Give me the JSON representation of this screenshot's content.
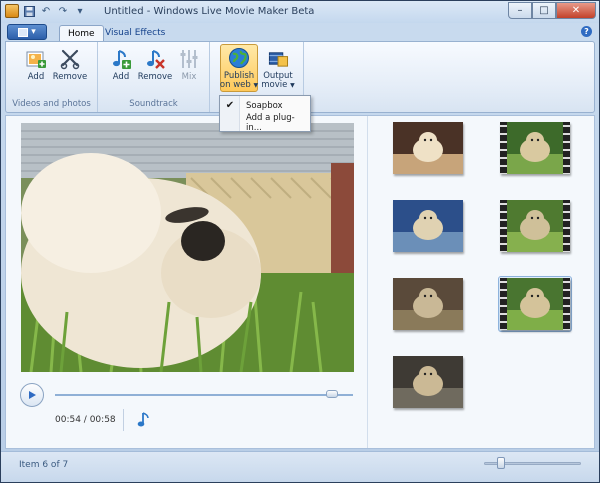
{
  "window": {
    "title": "Untitled - Windows Live Movie Maker Beta",
    "min_symbol": "–",
    "max_symbol": "□",
    "close_symbol": "✕"
  },
  "tabs": [
    {
      "label": "Home",
      "active": true
    },
    {
      "label": "Visual Effects",
      "active": false
    }
  ],
  "help_symbol": "?",
  "ribbon": {
    "groups": [
      {
        "label": "Videos and photos",
        "buttons": [
          {
            "label": "Add",
            "icon": "add-photo-icon"
          },
          {
            "label": "Remove",
            "icon": "remove-scissors-icon"
          }
        ]
      },
      {
        "label": "Soundtrack",
        "buttons": [
          {
            "label": "Add",
            "icon": "add-music-icon"
          },
          {
            "label": "Remove",
            "icon": "remove-music-icon"
          },
          {
            "label": "Mix",
            "icon": "mix-sliders-icon",
            "disabled": true
          }
        ]
      },
      {
        "label": "",
        "buttons": [
          {
            "label_line1": "Publish",
            "label_line2": "on web",
            "icon": "globe-icon",
            "pressed": true
          },
          {
            "label_line1": "Output",
            "label_line2": "movie",
            "icon": "output-film-icon"
          }
        ]
      }
    ]
  },
  "dropdown": {
    "items": [
      {
        "label": "Soapbox",
        "checked": true
      },
      {
        "label": "Add a plug-in...",
        "checked": false
      }
    ],
    "check_symbol": "✔"
  },
  "preview": {
    "time_current": "00:54",
    "time_total": "00:58",
    "time_separator": " / ",
    "progress": 0.93
  },
  "storyboard": {
    "clips": [
      {
        "type": "photo",
        "selected": false
      },
      {
        "type": "video",
        "selected": false
      },
      {
        "type": "photo",
        "selected": false
      },
      {
        "type": "video",
        "selected": false
      },
      {
        "type": "photo",
        "selected": false
      },
      {
        "type": "video",
        "selected": true
      },
      {
        "type": "photo",
        "selected": false
      }
    ]
  },
  "status": {
    "text": "Item 6 of 7",
    "zoom_level": 0.18
  },
  "colors": {
    "accent": "#2f6bc2",
    "pressed": "#ffc95a"
  }
}
